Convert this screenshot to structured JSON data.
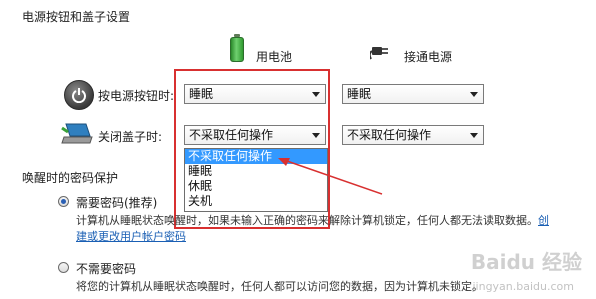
{
  "page": {
    "section_title": "电源按钮和盖子设置",
    "col_battery": "用电池",
    "col_plugged": "接通电源",
    "row_power_button": {
      "label": "按电源按钮时:",
      "battery_value": "睡眠",
      "plugged_value": "睡眠"
    },
    "row_lid": {
      "label": "关闭盖子时:",
      "battery_value": "不采取任何操作",
      "plugged_value": "不采取任何操作"
    },
    "dropdown_options": [
      "不采取任何操作",
      "睡眠",
      "休眠",
      "关机"
    ],
    "dropdown_selected_index": 0,
    "wake_title": "唤醒时的密码保护",
    "opt_require": {
      "label": "需要密码(推荐)",
      "desc": "计算机从睡眠状态唤醒时，如果未输入正确的密码来解除计算机锁定，任何人都无法读取数据。",
      "link1": "创",
      "link2": "建或更改用户帐户密码"
    },
    "opt_none": {
      "label": "不需要密码",
      "desc": "将您的计算机从睡眠状态唤醒时，任何人都可以访问您的数据，因为计算机未锁定。"
    },
    "watermark": "Baidu 经验",
    "watermark_sub": "jingyan.baidu.com",
    "colors": {
      "highlight": "#3399ff",
      "annotation": "#d83030",
      "link": "#1a5fb4"
    },
    "icons": [
      "battery-icon",
      "plug-icon",
      "power-button-icon",
      "laptop-lid-icon"
    ]
  }
}
